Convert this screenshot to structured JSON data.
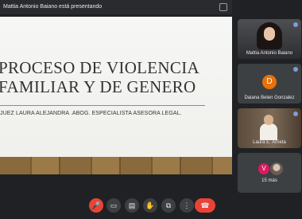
{
  "presenter_bar": {
    "text": "Mattia Antonio Baiano está presentando"
  },
  "slide": {
    "title_line1": "PROCESO DE VIOLENCIA",
    "title_line2": "FAMILIAR Y DE GENERO",
    "subtitle": "JUEZ LAURA ALEJANDRA .ABOG. ESPECIALISTA ASESORA LEGAL."
  },
  "participants": [
    {
      "name": "Mattia Antonio Baiano"
    },
    {
      "name": "Daiana Belen Gonzalez",
      "initial": "D"
    },
    {
      "name": "Laura E. Arrieta"
    },
    {
      "initial": "V",
      "more": "15 más"
    }
  ],
  "colors": {
    "background": "#202124",
    "tile": "#3c4043",
    "danger": "#ea4335",
    "accent_orange": "#e8710a"
  },
  "controls": {
    "icons": [
      "mic-off-icon",
      "camera-icon",
      "captions-icon",
      "raise-hand-icon",
      "present-icon",
      "more-icon",
      "hang-up-icon"
    ]
  }
}
